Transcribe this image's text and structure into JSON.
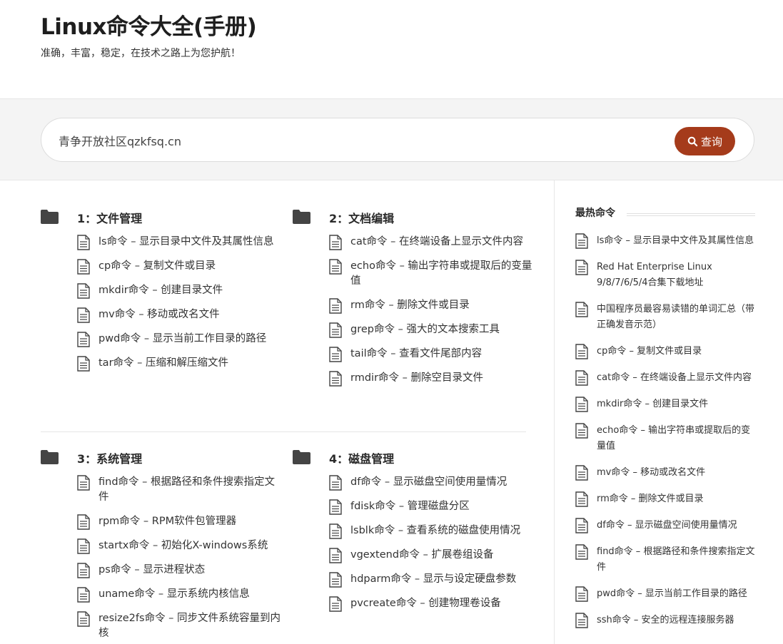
{
  "site": {
    "title": "Linux命令大全(手册)",
    "tagline": "准确，丰富，稳定，在技术之路上为您护航！"
  },
  "search": {
    "value": "青争开放社区qzkfsq.cn",
    "button_label": "查询",
    "accent_color": "#a53b1b"
  },
  "categories": [
    {
      "title": "1：文件管理",
      "items": [
        "ls命令 – 显示目录中文件及其属性信息",
        "cp命令 – 复制文件或目录",
        "mkdir命令 – 创建目录文件",
        "mv命令 – 移动或改名文件",
        "pwd命令 – 显示当前工作目录的路径",
        "tar命令 – 压缩和解压缩文件"
      ]
    },
    {
      "title": "2：文档编辑",
      "items": [
        "cat命令 – 在终端设备上显示文件内容",
        "echo命令 – 输出字符串或提取后的变量值",
        "rm命令 – 删除文件或目录",
        "grep命令 – 强大的文本搜索工具",
        "tail命令 – 查看文件尾部内容",
        "rmdir命令 – 删除空目录文件"
      ]
    },
    {
      "title": "3：系统管理",
      "items": [
        "find命令 – 根据路径和条件搜索指定文件",
        "rpm命令 – RPM软件包管理器",
        "startx命令 – 初始化X-windows系统",
        "ps命令 – 显示进程状态",
        "uname命令 – 显示系统内核信息",
        "resize2fs命令 – 同步文件系统容量到内核"
      ]
    },
    {
      "title": "4：磁盘管理",
      "items": [
        "df命令 – 显示磁盘空间使用量情况",
        "fdisk命令 – 管理磁盘分区",
        "lsblk命令 – 查看系统的磁盘使用情况",
        "vgextend命令 – 扩展卷组设备",
        "hdparm命令 – 显示与设定硬盘参数",
        "pvcreate命令 – 创建物理卷设备"
      ]
    }
  ],
  "sidebar": {
    "title": "最热命令",
    "items": [
      "ls命令 – 显示目录中文件及其属性信息",
      "Red Hat Enterprise Linux 9/8/7/6/5/4合集下载地址",
      "中国程序员最容易读错的单词汇总（带正确发音示范）",
      "cp命令 – 复制文件或目录",
      "cat命令 – 在终端设备上显示文件内容",
      "mkdir命令 – 创建目录文件",
      "echo命令 – 输出字符串或提取后的变量值",
      "mv命令 – 移动或改名文件",
      "rm命令 – 删除文件或目录",
      "df命令 – 显示磁盘空间使用量情况",
      "find命令 – 根据路径和条件搜索指定文件",
      "pwd命令 – 显示当前工作目录的路径",
      "ssh命令 – 安全的远程连接服务器"
    ]
  }
}
